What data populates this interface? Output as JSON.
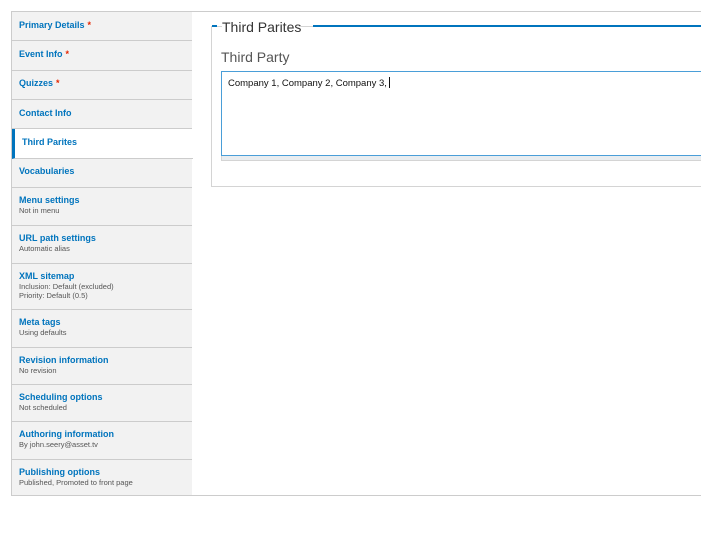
{
  "tabs": [
    {
      "title": "Primary Details",
      "required": true,
      "summary": "",
      "summary2": ""
    },
    {
      "title": "Event Info",
      "required": true,
      "summary": "",
      "summary2": ""
    },
    {
      "title": "Quizzes",
      "required": true,
      "summary": "",
      "summary2": ""
    },
    {
      "title": "Contact Info",
      "required": false,
      "summary": "",
      "summary2": ""
    },
    {
      "title": "Third Parites",
      "required": false,
      "summary": "",
      "summary2": "",
      "active": true
    },
    {
      "title": "Vocabularies",
      "required": false,
      "summary": "",
      "summary2": ""
    },
    {
      "title": "Menu settings",
      "required": false,
      "summary": "Not in menu",
      "summary2": ""
    },
    {
      "title": "URL path settings",
      "required": false,
      "summary": "Automatic alias",
      "summary2": ""
    },
    {
      "title": "XML sitemap",
      "required": false,
      "summary": "Inclusion: Default (excluded)",
      "summary2": "Priority: Default (0.5)"
    },
    {
      "title": "Meta tags",
      "required": false,
      "summary": "Using defaults",
      "summary2": ""
    },
    {
      "title": "Revision information",
      "required": false,
      "summary": "No revision",
      "summary2": ""
    },
    {
      "title": "Scheduling options",
      "required": false,
      "summary": "Not scheduled",
      "summary2": ""
    },
    {
      "title": "Authoring information",
      "required": false,
      "summary": "By john.seery@asset.tv",
      "summary2": ""
    },
    {
      "title": "Publishing options",
      "required": false,
      "summary": "Published, Promoted to front page",
      "summary2": ""
    }
  ],
  "required_marker": "*",
  "panel": {
    "legend": "Third Parites",
    "field_label": "Third Party",
    "field_value": "Company 1, Company 2, Company 3,"
  },
  "colors": {
    "link": "#0074bd",
    "required": "#e62600",
    "tab_bg": "#f2f2f2",
    "focus_border": "#4a9ed8"
  }
}
